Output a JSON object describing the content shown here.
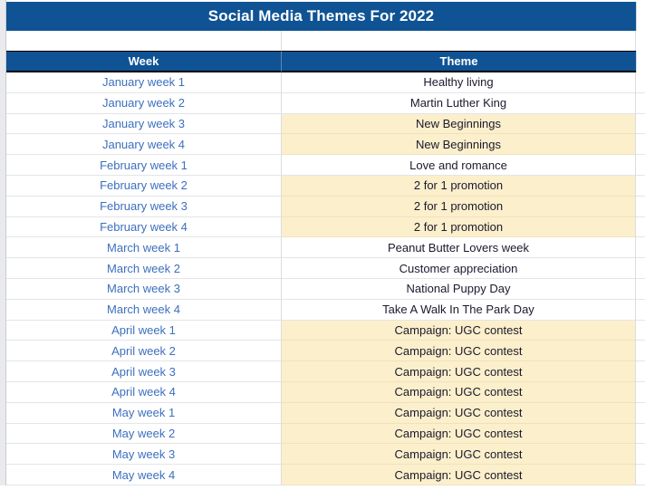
{
  "document": {
    "title": "Social Media Themes For 2022"
  },
  "table": {
    "columns": [
      {
        "key": "week",
        "label": "Week"
      },
      {
        "key": "theme",
        "label": "Theme"
      }
    ],
    "colors": {
      "header_background": "#0f5394",
      "header_text": "#ffffff",
      "week_text": "#3c6fbf",
      "theme_text": "#1a1a2e",
      "highlight_background": "#fcefcb",
      "gridline": "#dadce0",
      "gutter_background": "#e8eaed"
    },
    "rows": [
      {
        "week": "January week 1",
        "theme": "Healthy living",
        "highlighted": false
      },
      {
        "week": "January week 2",
        "theme": "Martin Luther King",
        "highlighted": false
      },
      {
        "week": "January week 3",
        "theme": "New Beginnings",
        "highlighted": true
      },
      {
        "week": "January week 4",
        "theme": "New Beginnings",
        "highlighted": true
      },
      {
        "week": "February week 1",
        "theme": "Love and romance",
        "highlighted": false
      },
      {
        "week": "February week 2",
        "theme": "2 for 1 promotion",
        "highlighted": true
      },
      {
        "week": "February week 3",
        "theme": "2 for 1 promotion",
        "highlighted": true
      },
      {
        "week": "February week 4",
        "theme": "2 for 1 promotion",
        "highlighted": true
      },
      {
        "week": "March week 1",
        "theme": "Peanut Butter Lovers week",
        "highlighted": false
      },
      {
        "week": "March week 2",
        "theme": "Customer appreciation",
        "highlighted": false
      },
      {
        "week": "March week 3",
        "theme": "National Puppy Day",
        "highlighted": false
      },
      {
        "week": "March week 4",
        "theme": "Take A Walk In The Park Day",
        "highlighted": false
      },
      {
        "week": "April week 1",
        "theme": "Campaign: UGC contest",
        "highlighted": true
      },
      {
        "week": "April week 2",
        "theme": "Campaign: UGC contest",
        "highlighted": true
      },
      {
        "week": "April week 3",
        "theme": "Campaign: UGC contest",
        "highlighted": true
      },
      {
        "week": "April week 4",
        "theme": "Campaign: UGC contest",
        "highlighted": true
      },
      {
        "week": "May week 1",
        "theme": "Campaign: UGC contest",
        "highlighted": true
      },
      {
        "week": "May week 2",
        "theme": "Campaign: UGC contest",
        "highlighted": true
      },
      {
        "week": "May week 3",
        "theme": "Campaign: UGC contest",
        "highlighted": true
      },
      {
        "week": "May week 4",
        "theme": "Campaign: UGC contest",
        "highlighted": true
      }
    ]
  }
}
